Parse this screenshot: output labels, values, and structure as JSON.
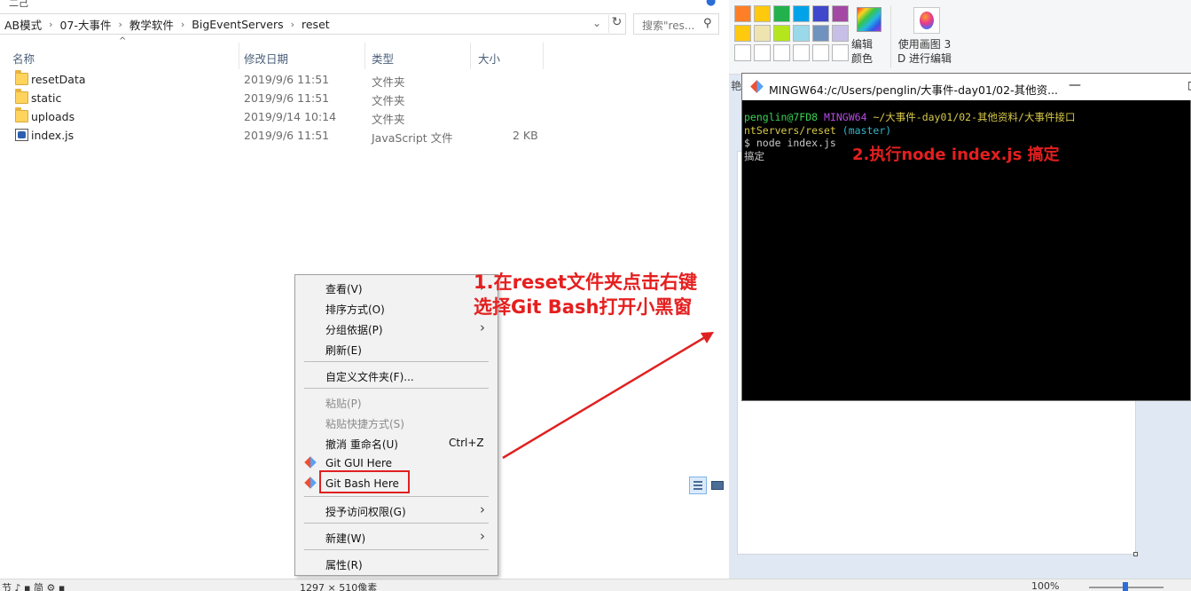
{
  "explorer": {
    "top_fragment": "二己",
    "breadcrumbs": [
      "AB模式",
      "07-大事件",
      "教学软件",
      "BigEventServers",
      "reset"
    ],
    "search_placeholder": "搜索\"res...",
    "columns": {
      "name": "名称",
      "date": "修改日期",
      "type": "类型",
      "size": "大小"
    },
    "files": [
      {
        "name": "resetData",
        "date": "2019/9/6 11:51",
        "type": "文件夹",
        "size": "",
        "icon": "folder-icon"
      },
      {
        "name": "static",
        "date": "2019/9/6 11:51",
        "type": "文件夹",
        "size": "",
        "icon": "folder-icon"
      },
      {
        "name": "uploads",
        "date": "2019/9/14 10:14",
        "type": "文件夹",
        "size": "",
        "icon": "folder-icon"
      },
      {
        "name": "index.js",
        "date": "2019/9/6 11:51",
        "type": "JavaScript 文件",
        "size": "2 KB",
        "icon": "js-file-icon"
      }
    ]
  },
  "context_menu": {
    "items": [
      {
        "label": "查看(V)",
        "submenu": true
      },
      {
        "label": "排序方式(O)",
        "submenu": true
      },
      {
        "label": "分组依据(P)",
        "submenu": true
      },
      {
        "label": "刷新(E)"
      },
      {
        "label": "自定义文件夹(F)..."
      },
      {
        "label": "粘贴(P)",
        "disabled": true
      },
      {
        "label": "粘贴快捷方式(S)",
        "disabled": true
      },
      {
        "label": "撤消 重命名(U)",
        "shortcut": "Ctrl+Z"
      },
      {
        "label": "Git GUI Here"
      },
      {
        "label": "Git Bash Here",
        "highlighted": true
      },
      {
        "label": "授予访问权限(G)",
        "submenu": true
      },
      {
        "label": "新建(W)",
        "submenu": true
      },
      {
        "label": "属性(R)"
      }
    ]
  },
  "terminal": {
    "title": "MINGW64:/c/Users/penglin/大事件-day01/02-其他资...",
    "user_host": "penglin@7FD8",
    "env": "MINGW64",
    "path_line1": "~/大事件-day01/02-其他资料/大事件接口",
    "path_line2": "ntServers/reset",
    "branch": "(master)",
    "command": "$ node index.js",
    "output": "搞定"
  },
  "paint": {
    "edit_colors_label": [
      "编辑",
      "颜色"
    ],
    "paint3d_label": [
      "使用画图 3",
      "D 进行编辑"
    ],
    "side_fragment": "艳",
    "palette": [
      "#ff7f27",
      "#ffc90e",
      "#22b14c",
      "#00a2e8",
      "#3f48cc",
      "#a349a4",
      "#ffc90e",
      "#efe4b0",
      "#b5e61d",
      "#99d9ea",
      "#7092be",
      "#c8bfe7",
      "#ffffff",
      "#ffffff",
      "#ffffff",
      "#ffffff",
      "#ffffff",
      "#ffffff"
    ]
  },
  "statusbar": {
    "left_fragment": "节 ♪ ▪ 简 ⚙ ▪",
    "dimensions": "1297 × 510像素",
    "zoom": "100%"
  },
  "annotations": {
    "step1_line1": "1.在reset文件夹点击右键",
    "step1_line2": "选择Git Bash打开小黑窗",
    "step2": "2.执行node index.js 搞定",
    "color": "#e51f1f"
  }
}
